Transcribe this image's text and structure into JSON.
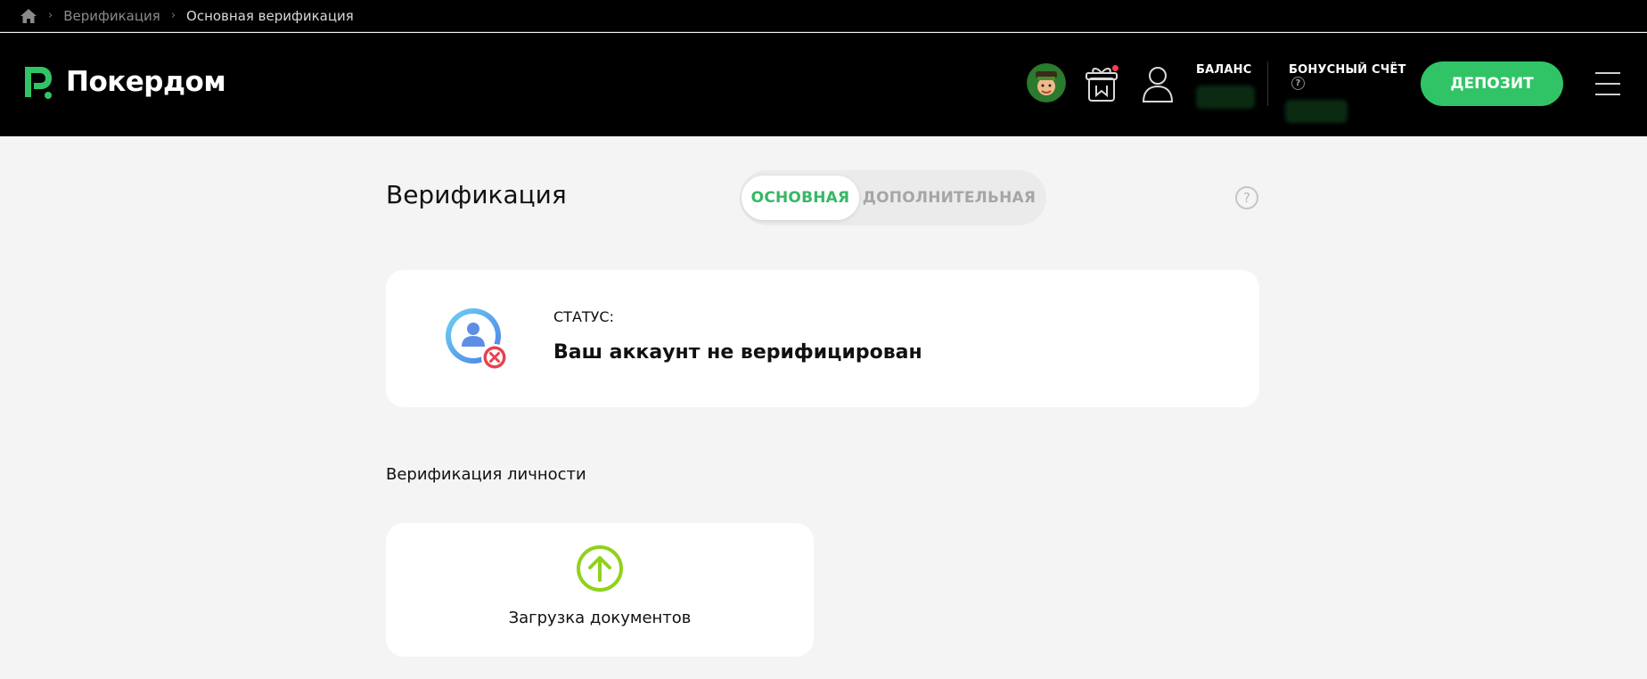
{
  "breadcrumb": {
    "items": [
      {
        "label": "Верификация"
      },
      {
        "label": "Основная верификация"
      }
    ]
  },
  "header": {
    "logo_text": "Покердом",
    "balance_label": "БАЛАНС",
    "bonus_label": "БОНУСНЫЙ СЧЁТ",
    "bonus_help": "?",
    "deposit_label": "ДЕПОЗИТ",
    "notification_color": "#ff3b4e"
  },
  "page": {
    "title": "Верификация",
    "tabs": [
      {
        "label": "ОСНОВНАЯ",
        "active": true
      },
      {
        "label": "ДОПОЛНИТЕЛЬНАЯ",
        "active": false
      }
    ],
    "help": "?"
  },
  "status": {
    "label": "СТАТУС:",
    "value": "Ваш аккаунт не верифицирован"
  },
  "identity": {
    "section_title": "Верификация личности",
    "upload_label": "Загрузка документов"
  },
  "colors": {
    "brand_green": "#31c466",
    "tab_active": "#37b865",
    "upload_icon": "#8fd21c",
    "error_red": "#e8424f"
  }
}
